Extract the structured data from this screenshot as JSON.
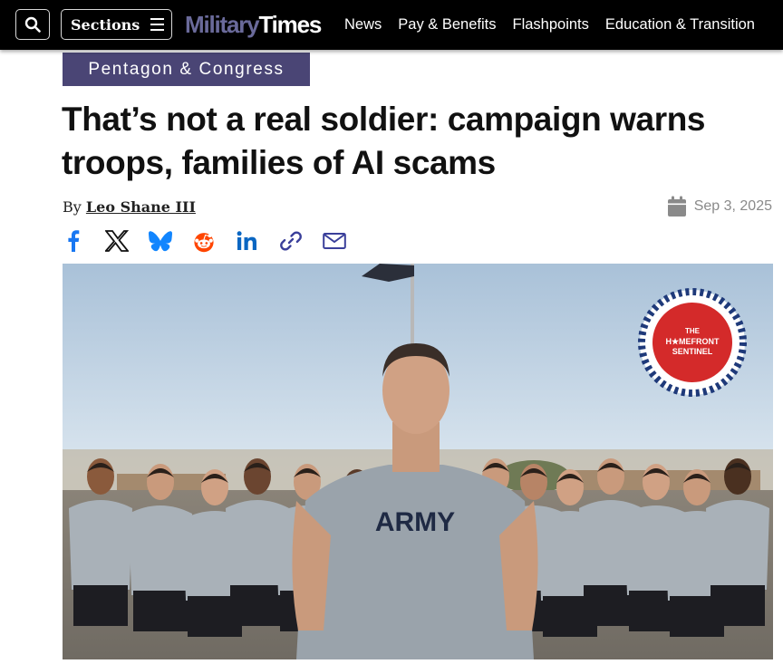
{
  "nav": {
    "search_label": "Search",
    "sections_label": "Sections",
    "logo_part1": "Military",
    "logo_part2": "Times",
    "links": [
      "News",
      "Pay & Benefits",
      "Flashpoints",
      "Education & Transition"
    ]
  },
  "article": {
    "category": "Pentagon & Congress",
    "headline": "That’s not a real soldier: campaign warns troops, families of AI scams",
    "byline_prefix": "By",
    "author": "Leo Shane III",
    "date": "Sep 3, 2025",
    "share_icons": [
      "facebook-icon",
      "x-icon",
      "bluesky-icon",
      "reddit-icon",
      "linkedin-icon",
      "link-icon",
      "email-icon"
    ]
  },
  "hero": {
    "badge_line1": "THE",
    "badge_line2": "H★MEFRONT",
    "badge_line3": "SENTINEL",
    "shirt_text": "ARMY",
    "caption": ""
  },
  "colors": {
    "nav_bg": "#000000",
    "category_bg": "#4a4575",
    "logo_military": "#6a6a9a",
    "facebook": "#1877f2",
    "bluesky": "#1185fe",
    "reddit": "#ff4500",
    "linkedin": "#0a66c2",
    "link": "#3a3f9a",
    "email": "#3a3f9a"
  }
}
